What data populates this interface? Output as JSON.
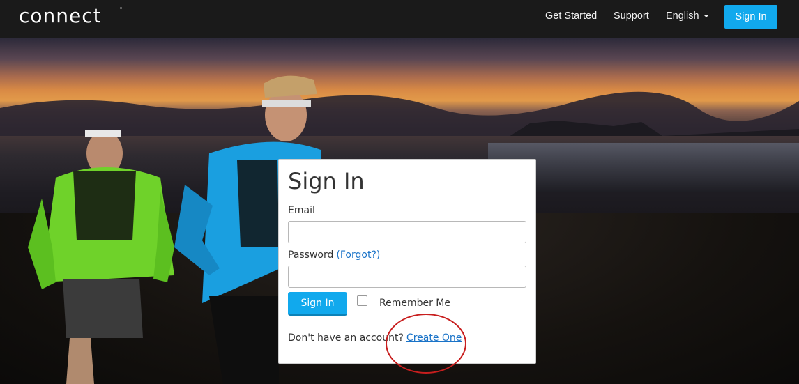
{
  "header": {
    "logo_text": "connect",
    "nav": {
      "get_started": "Get Started",
      "support": "Support",
      "language": "English",
      "sign_in": "Sign In"
    }
  },
  "form": {
    "title": "Sign In",
    "email_label": "Email",
    "email_value": "",
    "password_label": "Password",
    "forgot_label": "(Forgot?)",
    "password_value": "",
    "submit_label": "Sign In",
    "remember_label": "Remember Me",
    "remember_checked": false,
    "no_account_text": "Don't have an account?",
    "create_label": "Create One"
  },
  "colors": {
    "accent": "#11a9ed",
    "link": "#1a73c8",
    "annotation": "#c81e1e",
    "topbar": "#1a1a1a"
  },
  "icons": [
    "language-caret-icon"
  ]
}
